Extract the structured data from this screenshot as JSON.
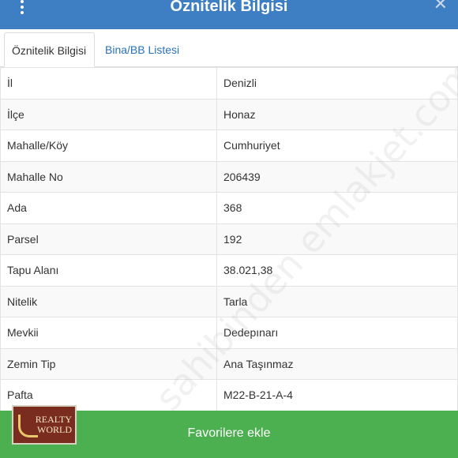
{
  "header": {
    "title": "Öznitelik Bilgisi"
  },
  "tabs": [
    {
      "label": "Öznitelik Bilgisi",
      "active": true
    },
    {
      "label": "Bina/BB Listesi",
      "active": false
    }
  ],
  "rows": [
    {
      "key": "İl",
      "value": "Denizli"
    },
    {
      "key": "İlçe",
      "value": "Honaz"
    },
    {
      "key": "Mahalle/Köy",
      "value": "Cumhuriyet"
    },
    {
      "key": "Mahalle No",
      "value": "206439"
    },
    {
      "key": "Ada",
      "value": "368"
    },
    {
      "key": "Parsel",
      "value": "192"
    },
    {
      "key": "Tapu Alanı",
      "value": "38.021,38"
    },
    {
      "key": "Nitelik",
      "value": "Tarla"
    },
    {
      "key": "Mevkii",
      "value": "Dedepınarı"
    },
    {
      "key": "Zemin Tip",
      "value": "Ana Taşınmaz"
    },
    {
      "key": "Pafta",
      "value": "M22-B-21-A-4"
    }
  ],
  "watermark": "sahibinden emlakjet.com",
  "footer": {
    "button_label": "Favorilere ekle"
  },
  "logo": {
    "line1": "REALTY",
    "line2": "WORLD"
  },
  "colors": {
    "header": "#3d7fc2",
    "footer": "#4caf50",
    "tab_link": "#2a72b8"
  }
}
